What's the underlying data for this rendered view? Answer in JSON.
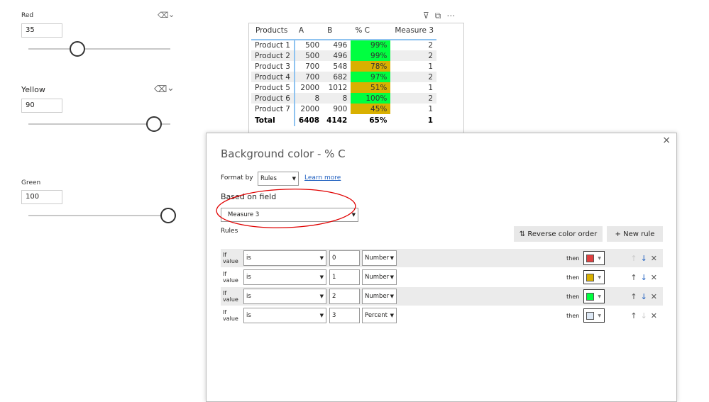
{
  "slicers": [
    {
      "label": "Red",
      "value": "35",
      "fraction": 0.35
    },
    {
      "label": "Yellow",
      "value": "90",
      "fraction": 0.9
    },
    {
      "label": "Green",
      "value": "100",
      "fraction": 1.0
    }
  ],
  "table": {
    "headers": [
      "Products",
      "A",
      "B",
      "% C",
      "Measure 3"
    ],
    "rows": [
      [
        "Product 1",
        "500",
        "496",
        "99%",
        "2"
      ],
      [
        "Product 2",
        "500",
        "496",
        "99%",
        "2"
      ],
      [
        "Product 3",
        "700",
        "548",
        "78%",
        "1"
      ],
      [
        "Product 4",
        "700",
        "682",
        "97%",
        "2"
      ],
      [
        "Product 5",
        "2000",
        "1012",
        "51%",
        "1"
      ],
      [
        "Product 6",
        "8",
        "8",
        "100%",
        "2"
      ],
      [
        "Product 7",
        "2000",
        "900",
        "45%",
        "1"
      ]
    ],
    "row_colors": [
      "#00ff40",
      "#00ff40",
      "#d9b000",
      "#00ff40",
      "#d9b000",
      "#00ff40",
      "#d9b000"
    ],
    "total": [
      "Total",
      "6408",
      "4142",
      "65%",
      "1"
    ]
  },
  "dialog": {
    "title": "Background color - % C",
    "format_by_label": "Format by",
    "format_by_value": "Rules",
    "learn_more": "Learn more",
    "based_on_label": "Based on field",
    "based_on_value": "Measure 3",
    "rules_label": "Rules",
    "reverse_label": "Reverse color order",
    "new_rule_label": "New rule",
    "rules": [
      {
        "if": "If value",
        "op": "is",
        "value": "0",
        "type": "Number",
        "then": "then",
        "color": "#e04040"
      },
      {
        "if": "If value",
        "op": "is",
        "value": "1",
        "type": "Number",
        "then": "then",
        "color": "#d9b000"
      },
      {
        "if": "If value",
        "op": "is",
        "value": "2",
        "type": "Number",
        "then": "then",
        "color": "#00ff40"
      },
      {
        "if": "If value",
        "op": "is",
        "value": "3",
        "type": "Percent",
        "then": "then",
        "color": "#dde8f5"
      }
    ]
  }
}
